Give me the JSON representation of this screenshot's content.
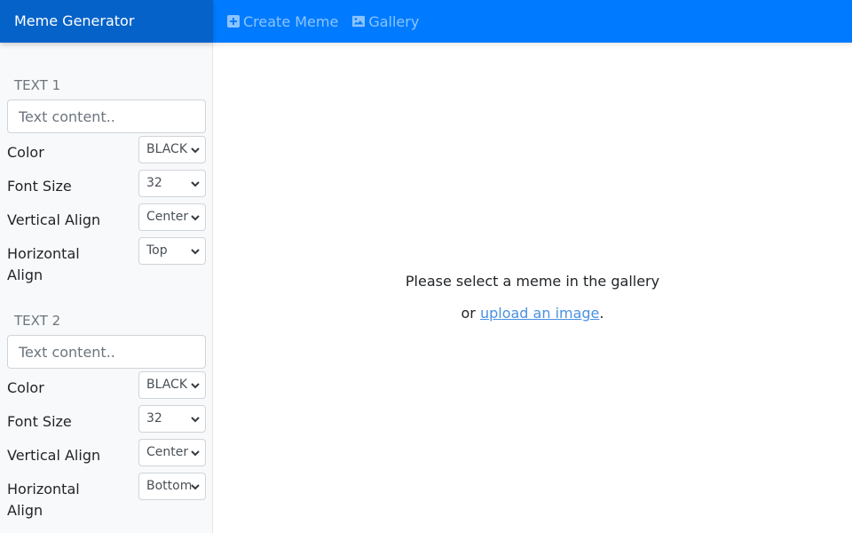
{
  "app": {
    "title": "Meme Generator"
  },
  "nav": {
    "items": [
      {
        "label": "Create Meme",
        "icon": "plus-square-icon"
      },
      {
        "label": "Gallery",
        "icon": "image-icon"
      }
    ]
  },
  "sidebar": {
    "texts": [
      {
        "title": "TEXT 1",
        "placeholder": "Text content..",
        "color_label": "Color",
        "color_value": "BLACK",
        "size_label": "Font Size",
        "size_value": "32",
        "valign_label": "Vertical Align",
        "valign_value": "Center",
        "halign_label": "Horizontal Align",
        "halign_value": "Top"
      },
      {
        "title": "TEXT 2",
        "placeholder": "Text content..",
        "color_label": "Color",
        "color_value": "BLACK",
        "size_label": "Font Size",
        "size_value": "32",
        "valign_label": "Vertical Align",
        "valign_value": "Center",
        "halign_label": "Horizontal Align",
        "halign_value": "Bottom"
      }
    ]
  },
  "main": {
    "line1": "Please select a meme in the gallery",
    "line2_prefix": "or ",
    "upload_link": "upload an image",
    "line2_suffix": "."
  }
}
